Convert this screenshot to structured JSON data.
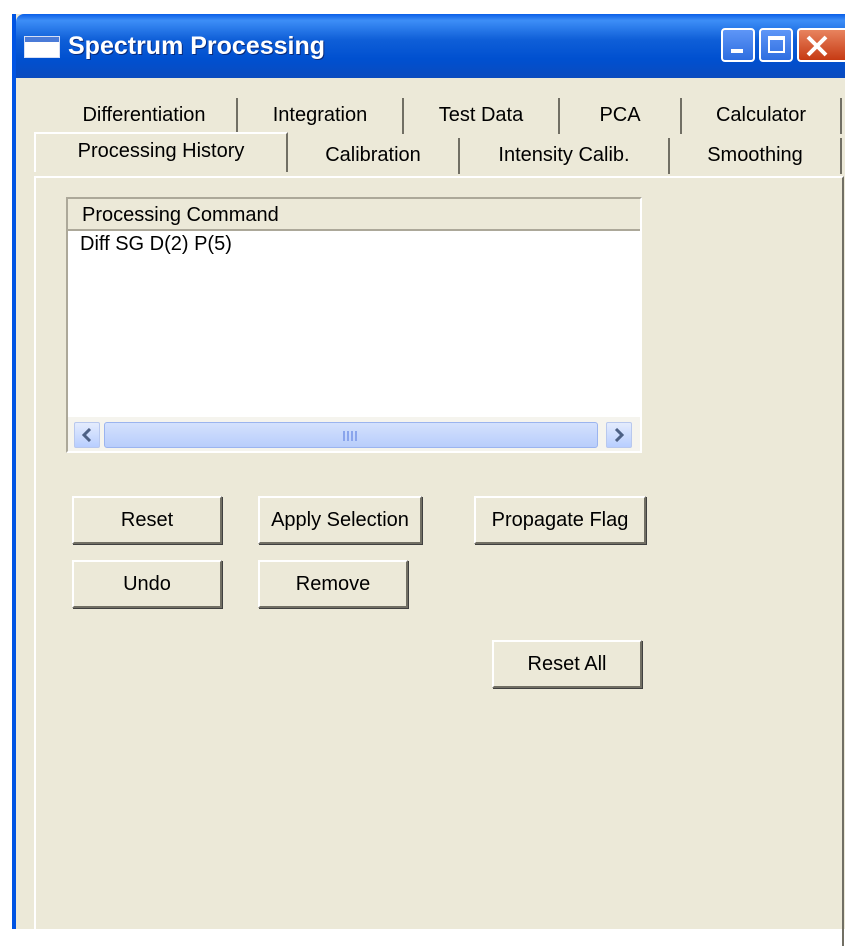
{
  "window": {
    "title": "Spectrum Processing"
  },
  "tabs": {
    "row1": [
      "Differentiation",
      "Integration",
      "Test Data",
      "PCA",
      "Calculator"
    ],
    "row2": [
      "Processing History",
      "Calibration",
      "Intensity Calib.",
      "Smoothing"
    ],
    "active": "Processing History"
  },
  "list": {
    "header": "Processing Command",
    "rows": [
      "Diff SG D(2) P(5)"
    ]
  },
  "buttons": {
    "reset": "Reset",
    "apply_selection": "Apply Selection",
    "propagate_flag": "Propagate Flag",
    "undo": "Undo",
    "remove": "Remove",
    "reset_all": "Reset All"
  },
  "icons": [
    "window-app-icon",
    "minimize-icon",
    "maximize-icon",
    "close-icon",
    "scroll-left-icon",
    "scroll-right-icon",
    "scroll-grip-icon"
  ]
}
